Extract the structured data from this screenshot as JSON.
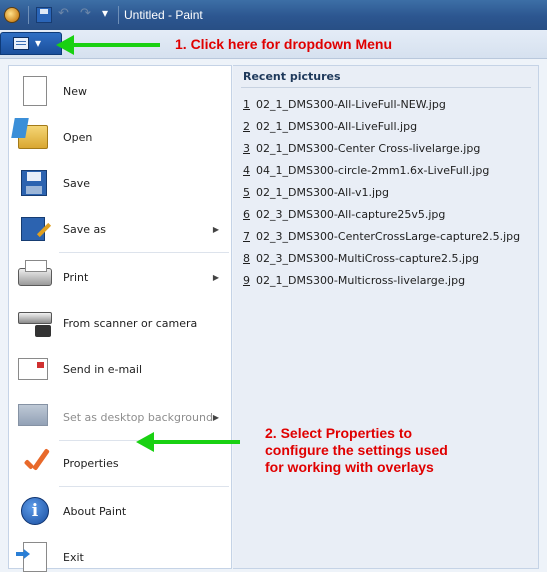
{
  "titlebar": {
    "title": "Untitled - Paint",
    "icons": [
      "paint-logo-icon",
      "save-icon",
      "undo-icon",
      "redo-icon",
      "customize-dropdown-icon"
    ]
  },
  "annotations": {
    "step1": "1. Click here for dropdown Menu",
    "step2": [
      "2. Select Properties to",
      "configure the settings used",
      "for working with overlays"
    ],
    "arrow_color": "#19d112",
    "text_color": "#e00000"
  },
  "menu": {
    "items": [
      {
        "label": "New",
        "icon": "new-document-icon",
        "enabled": true,
        "submenu": false
      },
      {
        "label": "Open",
        "icon": "open-folder-icon",
        "enabled": true,
        "submenu": false
      },
      {
        "label": "Save",
        "icon": "floppy-icon",
        "enabled": true,
        "submenu": false
      },
      {
        "label": "Save as",
        "icon": "save-as-icon",
        "enabled": true,
        "submenu": true
      },
      {
        "label": "Print",
        "icon": "printer-icon",
        "enabled": true,
        "submenu": true
      },
      {
        "label": "From scanner or camera",
        "icon": "scanner-icon",
        "enabled": true,
        "submenu": false
      },
      {
        "label": "Send in e-mail",
        "icon": "email-icon",
        "enabled": true,
        "submenu": false
      },
      {
        "label": "Set as desktop background",
        "icon": "desktop-background-icon",
        "enabled": false,
        "submenu": true
      },
      {
        "label": "Properties",
        "icon": "checkmark-icon",
        "enabled": true,
        "submenu": false
      },
      {
        "label": "About Paint",
        "icon": "info-icon",
        "enabled": true,
        "submenu": false
      },
      {
        "label": "Exit",
        "icon": "exit-icon",
        "enabled": true,
        "submenu": false
      }
    ],
    "submenu_glyph": "▶"
  },
  "recent": {
    "title": "Recent pictures",
    "items": [
      {
        "num": "1",
        "name": "02_1_DMS300-All-LiveFull-NEW.jpg"
      },
      {
        "num": "2",
        "name": "02_1_DMS300-All-LiveFull.jpg"
      },
      {
        "num": "3",
        "name": "02_1_DMS300-Center Cross-livelarge.jpg"
      },
      {
        "num": "4",
        "name": "04_1_DMS300-circle-2mm1.6x-LiveFull.jpg"
      },
      {
        "num": "5",
        "name": "02_1_DMS300-All-v1.jpg"
      },
      {
        "num": "6",
        "name": "02_3_DMS300-All-capture25v5.jpg"
      },
      {
        "num": "7",
        "name": "02_3_DMS300-CenterCrossLarge-capture2.5.jpg"
      },
      {
        "num": "8",
        "name": "02_3_DMS300-MultiCross-capture2.5.jpg"
      },
      {
        "num": "9",
        "name": "02_1_DMS300-Multicross-livelarge.jpg"
      }
    ]
  }
}
